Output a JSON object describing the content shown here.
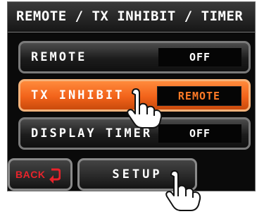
{
  "header": {
    "title": "REMOTE / TX INHIBIT / TIMER"
  },
  "menu": {
    "items": [
      {
        "label": "REMOTE",
        "value": "OFF",
        "active": false
      },
      {
        "label": "TX INHIBIT",
        "value": "REMOTE",
        "active": true
      },
      {
        "label": "DISPLAY TIMER",
        "value": "OFF",
        "active": false
      }
    ]
  },
  "footer": {
    "back_label": "BACK",
    "setup_label": "SETUP"
  },
  "colors": {
    "accent_orange": "#f2631a",
    "back_red": "#e8232b",
    "screen_bg": "#0a0a0a"
  },
  "icons": {
    "back": "back-arrow-icon",
    "pointer": "pointing-hand-icon"
  }
}
